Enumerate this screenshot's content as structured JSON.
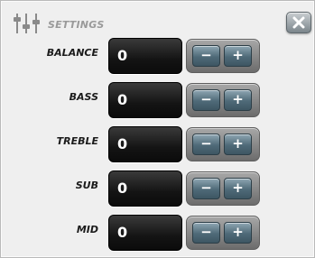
{
  "header": {
    "icon": "sliders-icon",
    "title": "SETTINGS",
    "close_icon": "close-icon"
  },
  "rows": [
    {
      "label": "BALANCE",
      "value": "0",
      "minus": "−",
      "plus": "+"
    },
    {
      "label": "BASS",
      "value": "0",
      "minus": "−",
      "plus": "+"
    },
    {
      "label": "TREBLE",
      "value": "0",
      "minus": "−",
      "plus": "+"
    },
    {
      "label": "SUB",
      "value": "0",
      "minus": "−",
      "plus": "+"
    },
    {
      "label": "MID",
      "value": "0",
      "minus": "−",
      "plus": "+"
    }
  ],
  "colors": {
    "panel": "#efefef",
    "value_bg": "#141414",
    "button_blue": "#4f6a78"
  }
}
